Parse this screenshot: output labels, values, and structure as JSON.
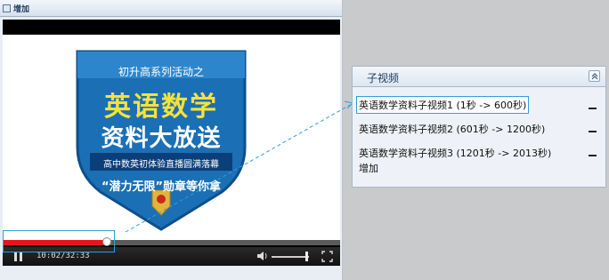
{
  "left_panel": {
    "title": "增加"
  },
  "player": {
    "ad": {
      "line1": "初升高系列活动之",
      "line2": "英语数学",
      "line3": "资料大放送",
      "line4": "高中数英初体验直播圆满落幕",
      "line5": "“潜力无限”勋章等你拿"
    },
    "progress": 0.31,
    "time": "10:02/32:33",
    "volume": 0.9
  },
  "sub_panel": {
    "title": "子视频",
    "items": [
      {
        "label": "英语数学资料子视频1 (1秒  -> 600秒)"
      },
      {
        "label": "英语数学资料子视频2 (601秒  -> 1200秒)"
      },
      {
        "label": "英语数学资料子视频3 (1201秒  -> 2013秒)"
      }
    ],
    "add_label": "增加"
  },
  "colors": {
    "progress": "#e3161c",
    "highlight": "#2ea0d8",
    "shield": "#1b6fb5"
  }
}
